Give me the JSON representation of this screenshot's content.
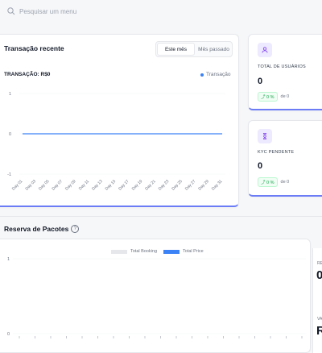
{
  "search": {
    "placeholder": "Pesquisar um menu"
  },
  "transactions": {
    "title": "Transação recente",
    "tabs": [
      {
        "label": "Este mês",
        "active": true
      },
      {
        "label": "Mês passado",
        "active": false
      }
    ],
    "summary_label": "TRANSAÇÃO: R$0",
    "legend_label": "Transação",
    "chart_data": {
      "type": "line",
      "title": "",
      "x": [
        "Day 01",
        "Day 03",
        "Day 05",
        "Day 07",
        "Day 09",
        "Day 11",
        "Day 13",
        "Day 15",
        "Day 17",
        "Day 19",
        "Day 21",
        "Day 23",
        "Day 25",
        "Day 27",
        "Day 29",
        "Day 31"
      ],
      "series": [
        {
          "name": "Transação",
          "values": [
            0,
            0,
            0,
            0,
            0,
            0,
            0,
            0,
            0,
            0,
            0,
            0,
            0,
            0,
            0,
            0
          ]
        }
      ],
      "ylim": [
        -1,
        1
      ],
      "yticks": [
        "1",
        "0",
        "-1"
      ],
      "grid": true,
      "legend": "top-right",
      "color": "#3b82f6"
    }
  },
  "stats": [
    {
      "label": "TOTAL DE USUÁRIOS",
      "value": "0",
      "badge": "0 %",
      "compare": "de 0",
      "icon": "user-icon"
    },
    {
      "label": "KYC PENDENTE",
      "value": "0",
      "badge": "0 %",
      "compare": "de 0",
      "icon": "hourglass-icon"
    }
  ],
  "packages": {
    "title": "Reserva de Pacotes",
    "legend": [
      {
        "name": "Total Booking",
        "color": "#e5e7eb"
      },
      {
        "name": "Total Price",
        "color": "#3b82f6"
      }
    ],
    "chart_data": {
      "type": "bar",
      "title": "",
      "series": [
        {
          "name": "Total Booking",
          "values": []
        },
        {
          "name": "Total Price",
          "values": []
        }
      ],
      "ylim": [
        0,
        1
      ],
      "yticks": [
        "1",
        "0"
      ],
      "legend": "top"
    },
    "right_panel": [
      {
        "label": "RE",
        "value": "0"
      },
      {
        "label": "VA",
        "value": "R"
      }
    ]
  }
}
